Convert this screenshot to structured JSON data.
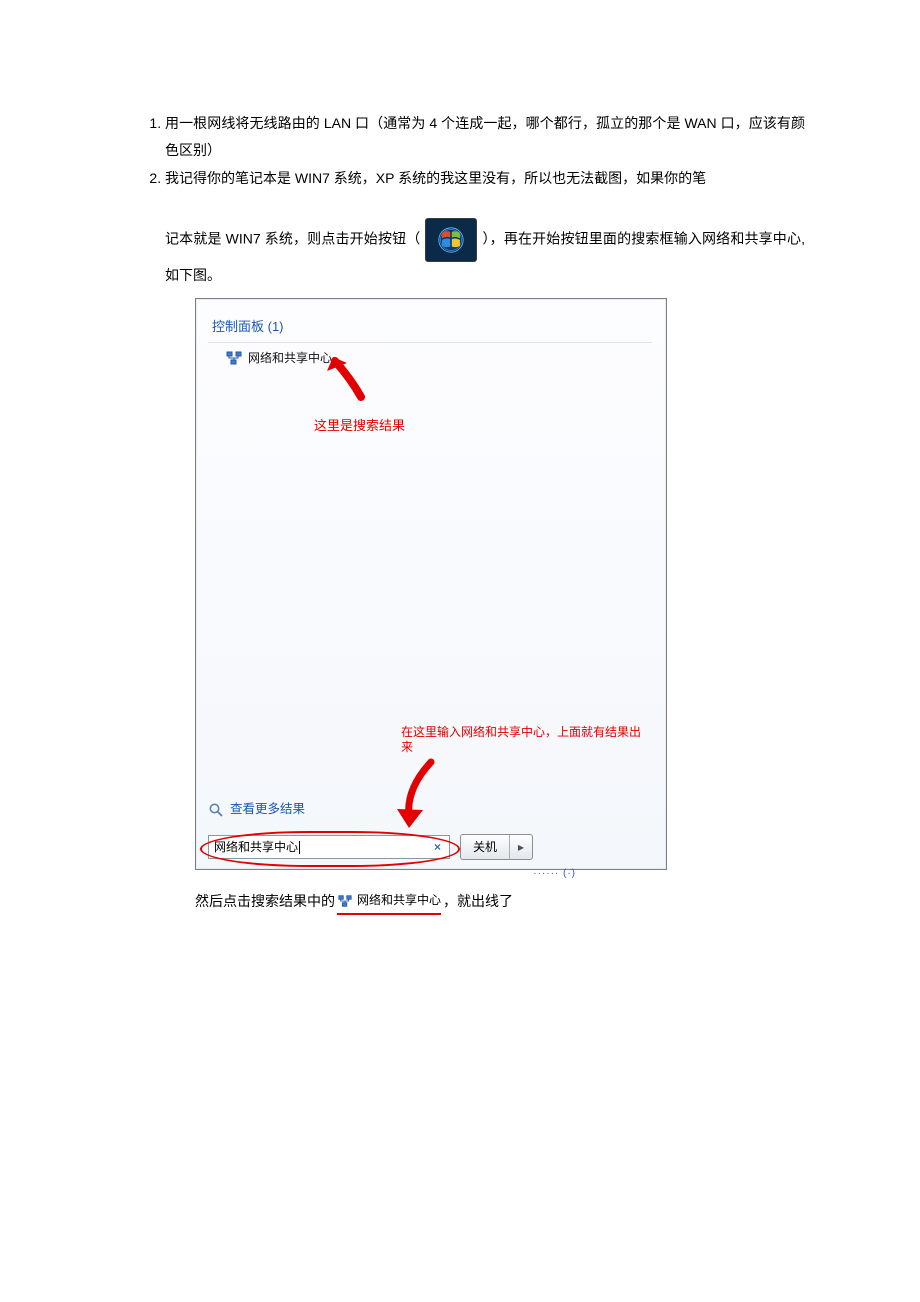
{
  "list": {
    "item1": "用一根网线将无线路由的 LAN 口（通常为 4 个连成一起，哪个都行，孤立的那个是 WAN 口，应该有颜色区别）",
    "item2a": "我记得你的笔记本是 WIN7 系统，XP 系统的我这里没有，所以也无法截图，如果你的笔",
    "item2b_before": "记本就是 WIN7 系统，则点击开始按钮（",
    "item2b_after": "），再在开始按钮里面的搜索框输入网络和共享中心,如下图。"
  },
  "figure": {
    "group_title": "控制面板 (1)",
    "result_item": "网络和共享中心",
    "annotation_top": "这里是搜索结果",
    "annotation_mid": "在这里输入网络和共享中心，上面就有结果出来",
    "more_results": "查看更多结果",
    "search_value": "网络和共享中心",
    "shutdown_label": "关机",
    "shutdown_arrow": "▸",
    "clear_symbol": "×",
    "cut_hint": "······ (·)"
  },
  "after": {
    "before": "然后点击搜索结果中的",
    "link_label": "网络和共享中心",
    "after": "，就出线了"
  }
}
